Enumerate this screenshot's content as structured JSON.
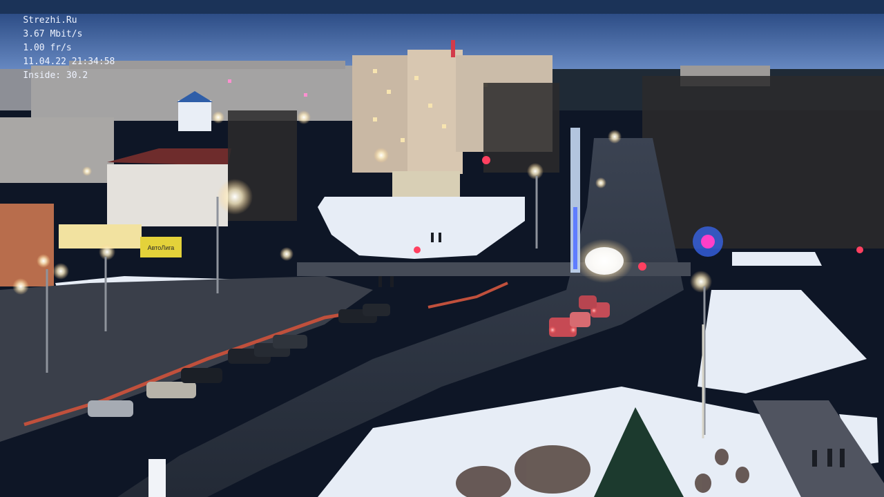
{
  "overlay": {
    "site": "Strezhi.Ru",
    "bitrate": "3.67 Mbit/s",
    "framerate": "1.00 fr/s",
    "datetime": "11.04.22 21:34:58",
    "inside": "Inside: 30.2"
  },
  "scene": {
    "signs": {
      "shop_sign": "АвтоЛига"
    }
  }
}
